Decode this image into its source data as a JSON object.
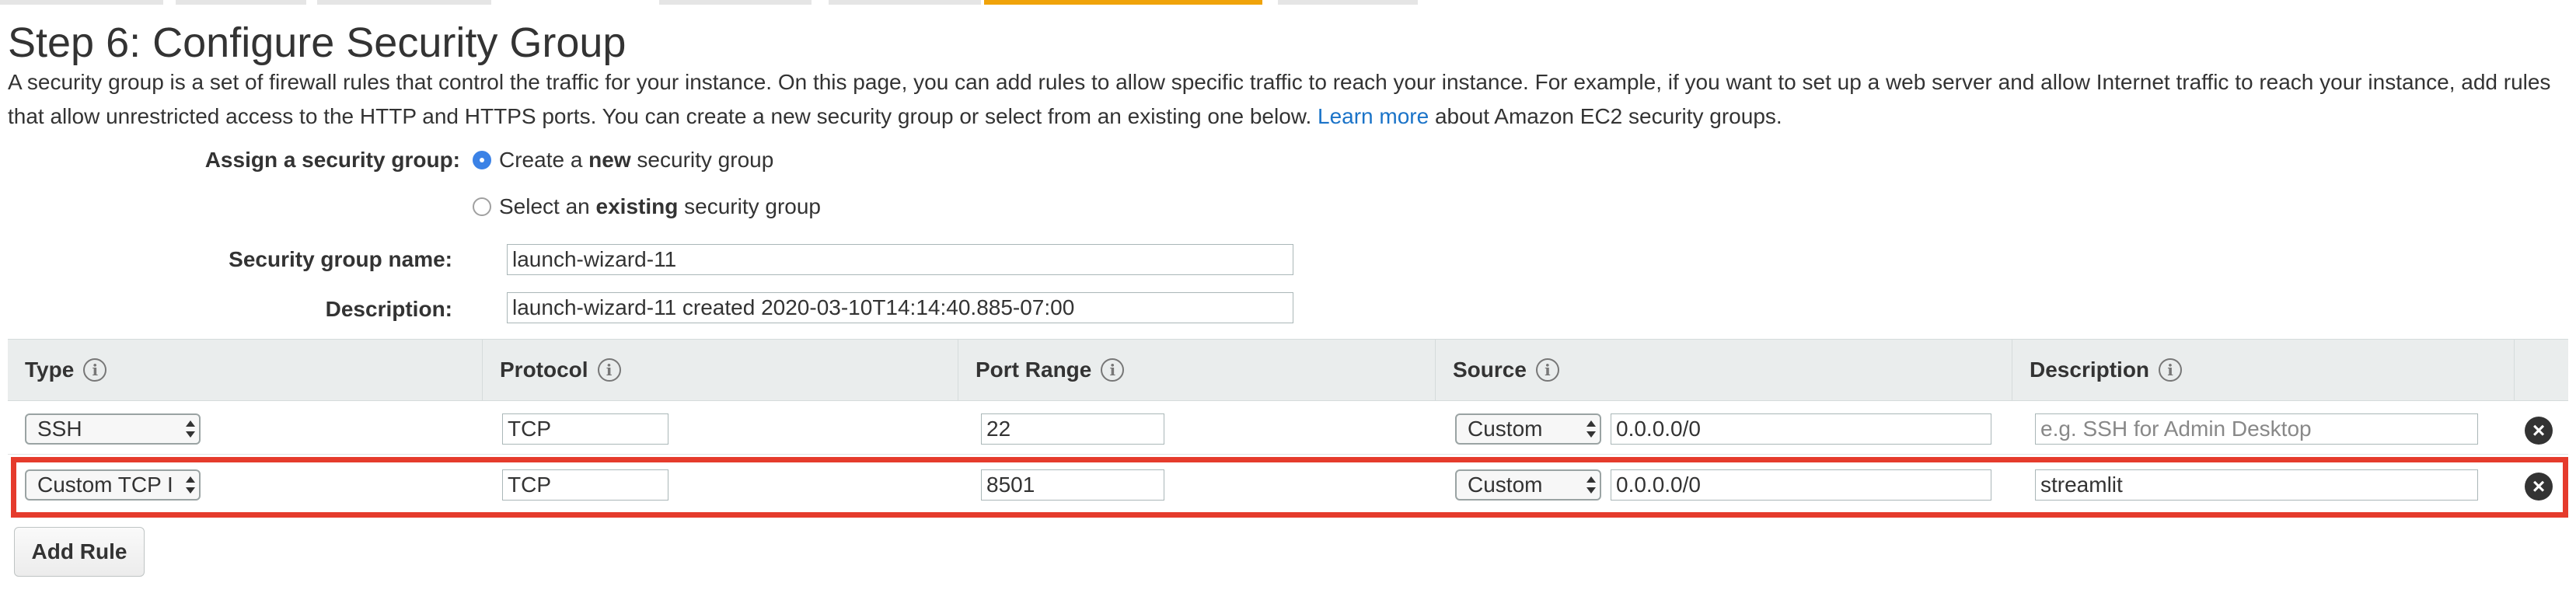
{
  "header": {
    "title": "Step 6: Configure Security Group",
    "intro_text": "A security group is a set of firewall rules that control the traffic for your instance. On this page, you can add rules to allow specific traffic to reach your instance. For example, if you want to set up a web server and allow Internet traffic to reach your instance, add rules that allow unrestricted access to the HTTP and HTTPS ports. You can create a new security group or select from an existing one below.",
    "learn_more_label": "Learn more",
    "intro_suffix": "about Amazon EC2 security groups."
  },
  "assign": {
    "label": "Assign a security group:",
    "option_new_prefix": "Create a ",
    "option_new_bold": "new",
    "option_new_suffix": " security group",
    "option_existing_prefix": "Select an ",
    "option_existing_bold": "existing",
    "option_existing_suffix": " security group",
    "selected": "new"
  },
  "group": {
    "name_label": "Security group name:",
    "name_value": "launch-wizard-11",
    "description_label": "Description:",
    "description_value": "launch-wizard-11 created 2020-03-10T14:14:40.885-07:00"
  },
  "table": {
    "headers": {
      "type": "Type",
      "protocol": "Protocol",
      "port_range": "Port Range",
      "source": "Source",
      "description": "Description"
    },
    "info_icon_glyph": "i",
    "remove_glyph": "×",
    "rows": [
      {
        "type": "SSH",
        "protocol": "TCP",
        "port_range": "22",
        "source_select": "Custom",
        "source_cidr": "0.0.0.0/0",
        "description": "",
        "description_placeholder": "e.g. SSH for Admin Desktop"
      },
      {
        "type": "Custom TCP I",
        "protocol": "TCP",
        "port_range": "8501",
        "source_select": "Custom",
        "source_cidr": "0.0.0.0/0",
        "description": "streamlit",
        "description_placeholder": ""
      }
    ]
  },
  "actions": {
    "add_rule_label": "Add Rule"
  },
  "colors": {
    "link": "#1a73c8",
    "highlight_border": "#e53b2c",
    "active_tab": "#f0a30a",
    "radio_selected": "#3b82e6"
  }
}
